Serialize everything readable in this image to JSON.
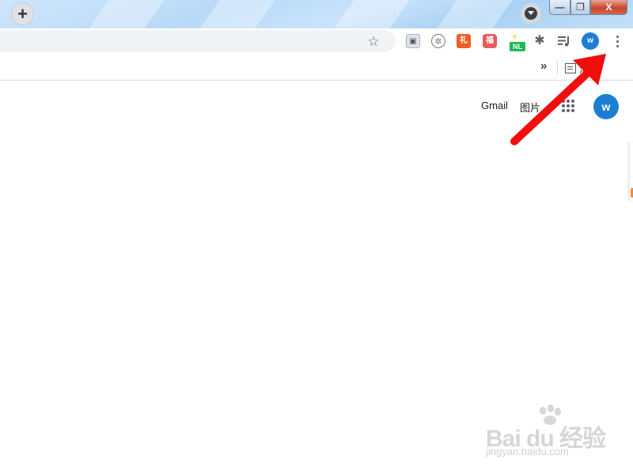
{
  "browser": {
    "new_tab_symbol": "+",
    "window_controls": {
      "minimize": "—",
      "maximize": "❐",
      "close": "X"
    },
    "toolbar": {
      "extensions": [
        {
          "name": "picture-extension",
          "glyph": "▣"
        },
        {
          "name": "wheel-extension",
          "glyph": "✲"
        },
        {
          "name": "gift-extension",
          "glyph": "礼"
        },
        {
          "name": "red-extension",
          "glyph": "福"
        },
        {
          "name": "nl-extension",
          "badge": "NL"
        }
      ],
      "profile_initial": "w"
    },
    "bookmarks_bar": {
      "overflow": "»",
      "reading_list_label": "清单"
    },
    "colors": {
      "accent_blue": "#1a7fd4",
      "arrow_red": "#f20d0d"
    }
  },
  "page": {
    "header_links": {
      "gmail": "Gmail",
      "images": "图片"
    },
    "account_initial": "w"
  },
  "watermark": {
    "logo": "Bai du 经验",
    "url": "jingyan.baidu.com"
  }
}
